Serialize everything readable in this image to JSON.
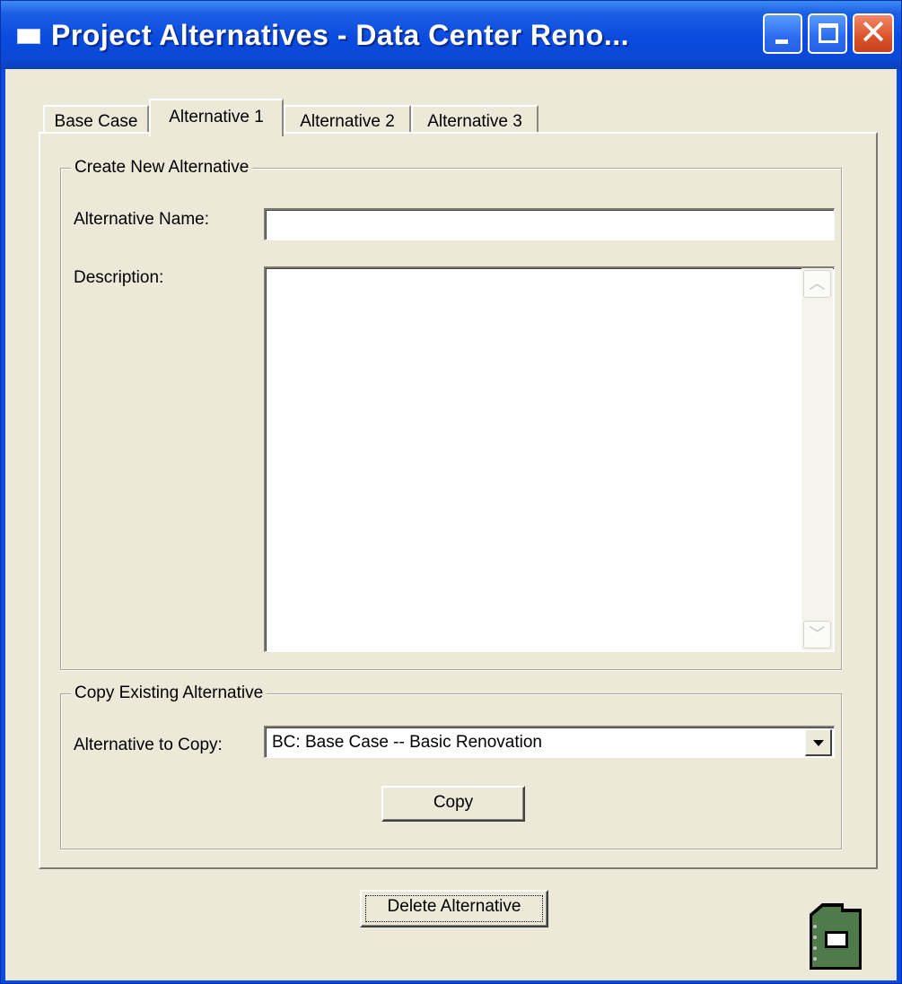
{
  "window": {
    "title": "Project Alternatives - Data Center Reno...",
    "controls": {
      "minimize": "minimize-icon",
      "maximize": "maximize-icon",
      "close": "close-icon"
    },
    "close_glyph": "✕"
  },
  "tabs": [
    {
      "label": "Base Case",
      "active": false
    },
    {
      "label": "Alternative 1",
      "active": true
    },
    {
      "label": "Alternative 2",
      "active": false
    },
    {
      "label": "Alternative 3",
      "active": false
    }
  ],
  "create_group": {
    "title": "Create New Alternative",
    "name_label": "Alternative Name:",
    "name_value": "",
    "description_label": "Description:",
    "description_value": ""
  },
  "copy_group": {
    "title": "Copy Existing Alternative",
    "copy_label": "Alternative to Copy:",
    "selected": "BC: Base Case -- Basic Renovation",
    "copy_button": "Copy"
  },
  "footer": {
    "delete_button": "Delete Alternative",
    "notebook_icon": "notebook-icon"
  },
  "colors": {
    "titlebar": "#0a4ae0",
    "face": "#ece9d8",
    "close_button": "#d9542c",
    "notebook": "#4f7a4a"
  }
}
